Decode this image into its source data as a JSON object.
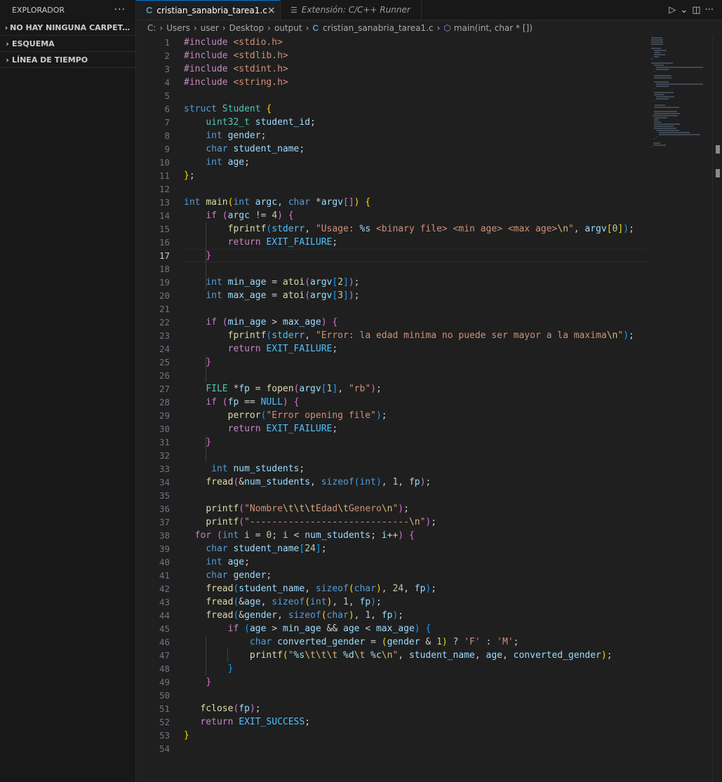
{
  "sidebar": {
    "title": "EXPLORADOR",
    "more_icon": "ellipsis-icon",
    "sections": [
      {
        "label": "NO HAY NINGUNA CARPETA ABIERTA",
        "icon": "chevron-right-icon"
      },
      {
        "label": "ESQUEMA",
        "icon": "chevron-right-icon"
      },
      {
        "label": "LÍNEA DE TIEMPO",
        "icon": "chevron-right-icon"
      }
    ]
  },
  "tabs": [
    {
      "label": "cristian_sanabria_tarea1.c",
      "icon": "c-file-icon",
      "active": true,
      "close": "×"
    },
    {
      "label": "Extensión: C/C++ Runner",
      "icon": "extension-icon",
      "active": false
    }
  ],
  "tab_actions": {
    "run": "▷",
    "run_menu": "⌄",
    "split": "◫",
    "more": "···"
  },
  "breadcrumb": {
    "segments": [
      "C:",
      "Users",
      "user",
      "Desktop",
      "output"
    ],
    "file": "cristian_sanabria_tarea1.c",
    "symbol": "main(int, char * [])"
  },
  "editor": {
    "current_line": 17,
    "line_count": 54,
    "accent": "#0078d4"
  }
}
